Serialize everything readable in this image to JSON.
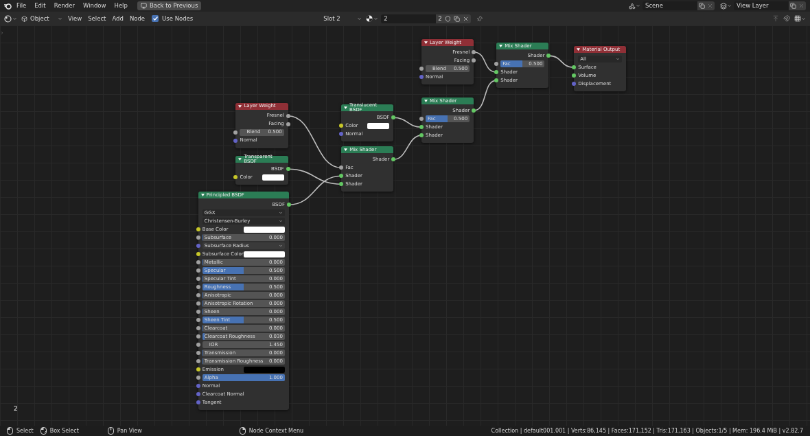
{
  "topbar": {
    "menus": [
      "File",
      "Edit",
      "Render",
      "Window",
      "Help"
    ],
    "back_button": "Back to Previous",
    "scene": "Scene",
    "view_layer": "View Layer"
  },
  "header": {
    "editor_mode": "Object",
    "menus": [
      "View",
      "Select",
      "Add",
      "Node"
    ],
    "use_nodes": {
      "label": "Use Nodes",
      "checked": true
    },
    "slot": "Slot 2",
    "material_name": "2",
    "material_users": "2"
  },
  "canvas": {
    "material_label": "2",
    "nodes": [
      {
        "title": "Layer Weight",
        "kind": "input",
        "rows": [
          {
            "kind": "output",
            "label": "Fresnel",
            "socket": {
              "color": "#a1a1a1"
            }
          },
          {
            "kind": "output",
            "label": "Facing",
            "socket": {
              "color": "#a1a1a1"
            }
          },
          {
            "kind": "number",
            "label": "Blend",
            "value": "0.500",
            "socket": {
              "color": "#a1a1a1"
            }
          },
          {
            "kind": "input",
            "label": "Normal",
            "socket": {
              "color": "#6363c7"
            }
          }
        ]
      },
      {
        "title": "Mix Shader",
        "kind": "shader",
        "rows": [
          {
            "kind": "output",
            "label": "Shader",
            "socket": {
              "color": "#63c763"
            }
          },
          {
            "kind": "slider",
            "label": "Fac",
            "value": "0.500",
            "level": 0.5,
            "socket": {
              "color": "#a1a1a1"
            }
          },
          {
            "kind": "input",
            "label": "Shader",
            "socket": {
              "color": "#63c763"
            }
          },
          {
            "kind": "input",
            "label": "Shader",
            "socket": {
              "color": "#63c763"
            }
          }
        ]
      },
      {
        "title": "Material Output",
        "kind": "output",
        "rows": [
          {
            "kind": "dropdown",
            "label": "All"
          },
          {
            "kind": "input",
            "label": "Surface",
            "socket": {
              "color": "#63c763"
            }
          },
          {
            "kind": "input",
            "label": "Volume",
            "socket": {
              "color": "#63c763"
            }
          },
          {
            "kind": "input",
            "label": "Displacement",
            "socket": {
              "color": "#6363c7"
            }
          }
        ]
      },
      {
        "title": "Layer Weight",
        "kind": "input",
        "rows": [
          {
            "kind": "output",
            "label": "Fresnel",
            "socket": {
              "color": "#a1a1a1"
            }
          },
          {
            "kind": "output",
            "label": "Facing",
            "socket": {
              "color": "#a1a1a1"
            }
          },
          {
            "kind": "number",
            "label": "Blend",
            "value": "0.500",
            "socket": {
              "color": "#a1a1a1"
            }
          },
          {
            "kind": "input",
            "label": "Normal",
            "socket": {
              "color": "#6363c7"
            }
          }
        ]
      },
      {
        "title": "Translucent BSDF",
        "kind": "shader",
        "rows": [
          {
            "kind": "output",
            "label": "BSDF",
            "socket": {
              "color": "#63c763"
            }
          },
          {
            "kind": "color",
            "label": "Color",
            "color": "#ffffff",
            "socket": {
              "color": "#c7c729"
            }
          },
          {
            "kind": "input",
            "label": "Normal",
            "socket": {
              "color": "#6363c7"
            }
          }
        ]
      },
      {
        "title": "Mix Shader",
        "kind": "shader",
        "rows": [
          {
            "kind": "output",
            "label": "Shader",
            "socket": {
              "color": "#63c763"
            }
          },
          {
            "kind": "slider",
            "label": "Fac",
            "value": "0.500",
            "level": 0.5,
            "socket": {
              "color": "#a1a1a1"
            }
          },
          {
            "kind": "input",
            "label": "Shader",
            "socket": {
              "color": "#63c763"
            }
          },
          {
            "kind": "input",
            "label": "Shader",
            "socket": {
              "color": "#63c763"
            }
          }
        ]
      },
      {
        "title": "Transparent BSDF",
        "kind": "shader",
        "rows": [
          {
            "kind": "output",
            "label": "BSDF",
            "socket": {
              "color": "#63c763"
            }
          },
          {
            "kind": "color",
            "label": "Color",
            "color": "#ffffff",
            "socket": {
              "color": "#c7c729"
            }
          }
        ]
      },
      {
        "title": "Mix Shader",
        "kind": "shader",
        "rows": [
          {
            "kind": "output",
            "label": "Shader",
            "socket": {
              "color": "#63c763"
            }
          },
          {
            "kind": "input",
            "label": "Fac",
            "socket": {
              "color": "#a1a1a1"
            }
          },
          {
            "kind": "input",
            "label": "Shader",
            "socket": {
              "color": "#63c763"
            }
          },
          {
            "kind": "input",
            "label": "Shader",
            "socket": {
              "color": "#63c763"
            }
          }
        ]
      },
      {
        "title": "Principled BSDF",
        "kind": "shader",
        "rows": [
          {
            "kind": "output",
            "label": "BSDF",
            "socket": {
              "color": "#63c763"
            }
          },
          {
            "kind": "dropdown",
            "label": "GGX"
          },
          {
            "kind": "dropdown",
            "label": "Christensen-Burley"
          },
          {
            "kind": "color",
            "label": "Base Color",
            "color": "#ffffff",
            "socket": {
              "color": "#c7c729"
            }
          },
          {
            "kind": "slider",
            "label": "Subsurface",
            "value": "0.000",
            "level": 0,
            "socket": {
              "color": "#a1a1a1"
            }
          },
          {
            "kind": "menu",
            "label": "Subsurface Radius",
            "socket": {
              "color": "#6363c7"
            }
          },
          {
            "kind": "color",
            "label": "Subsurface Color",
            "color": "#ffffff",
            "socket": {
              "color": "#c7c729"
            }
          },
          {
            "kind": "slider",
            "label": "Metallic",
            "value": "0.000",
            "level": 0,
            "socket": {
              "color": "#a1a1a1"
            }
          },
          {
            "kind": "slider",
            "label": "Specular",
            "value": "0.500",
            "level": 0.5,
            "socket": {
              "color": "#a1a1a1"
            }
          },
          {
            "kind": "slider",
            "label": "Specular Tint",
            "value": "0.000",
            "level": 0,
            "socket": {
              "color": "#a1a1a1"
            }
          },
          {
            "kind": "slider",
            "label": "Roughness",
            "value": "0.500",
            "level": 0.5,
            "socket": {
              "color": "#a1a1a1"
            }
          },
          {
            "kind": "slider",
            "label": "Anisotropic",
            "value": "0.000",
            "level": 0,
            "socket": {
              "color": "#a1a1a1"
            }
          },
          {
            "kind": "slider",
            "label": "Anisotropic Rotation",
            "value": "0.000",
            "level": 0,
            "socket": {
              "color": "#a1a1a1"
            }
          },
          {
            "kind": "slider",
            "label": "Sheen",
            "value": "0.000",
            "level": 0,
            "socket": {
              "color": "#a1a1a1"
            }
          },
          {
            "kind": "slider",
            "label": "Sheen Tint",
            "value": "0.500",
            "level": 0.5,
            "socket": {
              "color": "#a1a1a1"
            }
          },
          {
            "kind": "slider",
            "label": "Clearcoat",
            "value": "0.000",
            "level": 0,
            "socket": {
              "color": "#a1a1a1"
            }
          },
          {
            "kind": "slider",
            "label": "Clearcoat Roughness",
            "value": "0.030",
            "level": 0.03,
            "socket": {
              "color": "#a1a1a1"
            }
          },
          {
            "kind": "number",
            "label": "IOR",
            "value": "1.450",
            "socket": {
              "color": "#a1a1a1"
            }
          },
          {
            "kind": "slider",
            "label": "Transmission",
            "value": "0.000",
            "level": 0,
            "socket": {
              "color": "#a1a1a1"
            }
          },
          {
            "kind": "slider",
            "label": "Transmission Roughness",
            "value": "0.000",
            "level": 0,
            "socket": {
              "color": "#a1a1a1"
            }
          },
          {
            "kind": "color",
            "label": "Emission",
            "color": "#000000",
            "socket": {
              "color": "#c7c729"
            }
          },
          {
            "kind": "slider",
            "label": "Alpha",
            "value": "1.000",
            "level": 1,
            "socket": {
              "color": "#a1a1a1"
            }
          },
          {
            "kind": "input",
            "label": "Normal",
            "socket": {
              "color": "#6363c7"
            }
          },
          {
            "kind": "input",
            "label": "Clearcoat Normal",
            "socket": {
              "color": "#6363c7"
            }
          },
          {
            "kind": "input",
            "label": "Tangent",
            "socket": {
              "color": "#6363c7"
            }
          }
        ]
      }
    ]
  },
  "status_bar": {
    "hints": [
      {
        "kind": "left_click",
        "label": "Select"
      },
      {
        "kind": "drag",
        "label": "Box Select"
      },
      {
        "kind": "middle_click",
        "label": "Pan View"
      },
      {
        "kind": "right_click",
        "label": "Node Context Menu"
      }
    ],
    "stats": "Collection | default001.001 | Verts:86,145 | Faces:171,152 | Tris:171,163 | Objects:1/5 | Mem: 196.4 MiB | v2.82.7"
  }
}
